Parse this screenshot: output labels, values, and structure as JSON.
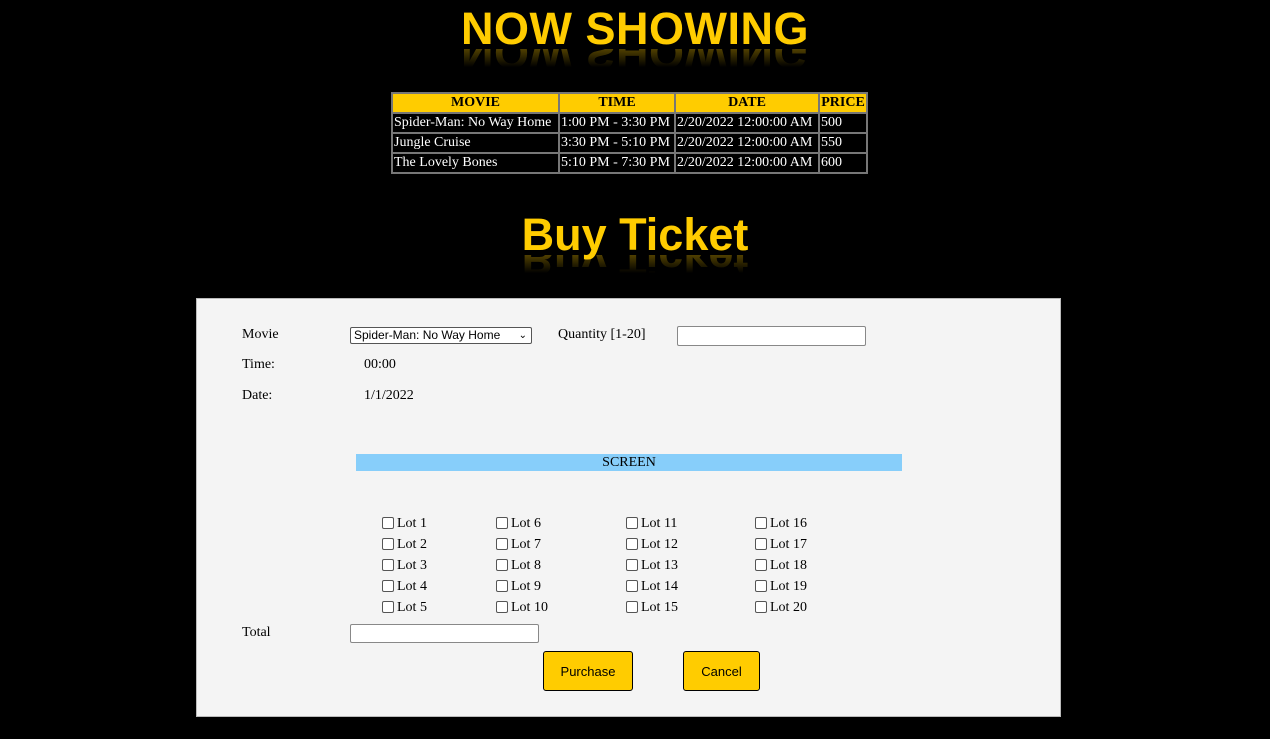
{
  "headings": {
    "now_showing": "NOW SHOWING",
    "buy_ticket": "Buy Ticket"
  },
  "schedule": {
    "columns": [
      "MOVIE",
      "TIME",
      "DATE",
      "PRICE"
    ],
    "rows": [
      [
        "Spider-Man: No Way Home",
        "1:00 PM - 3:30 PM",
        "2/20/2022 12:00:00 AM",
        "500"
      ],
      [
        "Jungle Cruise",
        "3:30 PM - 5:10 PM",
        "2/20/2022 12:00:00 AM",
        "550"
      ],
      [
        "The Lovely Bones",
        "5:10 PM - 7:30 PM",
        "2/20/2022 12:00:00 AM",
        "600"
      ]
    ]
  },
  "form": {
    "movie_label": "Movie",
    "movie_selected": "Spider-Man: No Way Home",
    "quantity_label": "Quantity [1-20]",
    "quantity_value": "",
    "time_label": "Time:",
    "time_value": "00:00",
    "date_label": "Date:",
    "date_value": "1/1/2022",
    "screen_label": "SCREEN",
    "total_label": "Total",
    "total_value": "",
    "lots": [
      "Lot 1",
      "Lot 2",
      "Lot 3",
      "Lot 4",
      "Lot 5",
      "Lot 6",
      "Lot 7",
      "Lot 8",
      "Lot 9",
      "Lot 10",
      "Lot 11",
      "Lot 12",
      "Lot 13",
      "Lot 14",
      "Lot 15",
      "Lot 16",
      "Lot 17",
      "Lot 18",
      "Lot 19",
      "Lot 20"
    ],
    "purchase_label": "Purchase",
    "cancel_label": "Cancel"
  },
  "colors": {
    "accent": "#ffcc00",
    "background": "#000000",
    "screen": "#87cefa"
  }
}
